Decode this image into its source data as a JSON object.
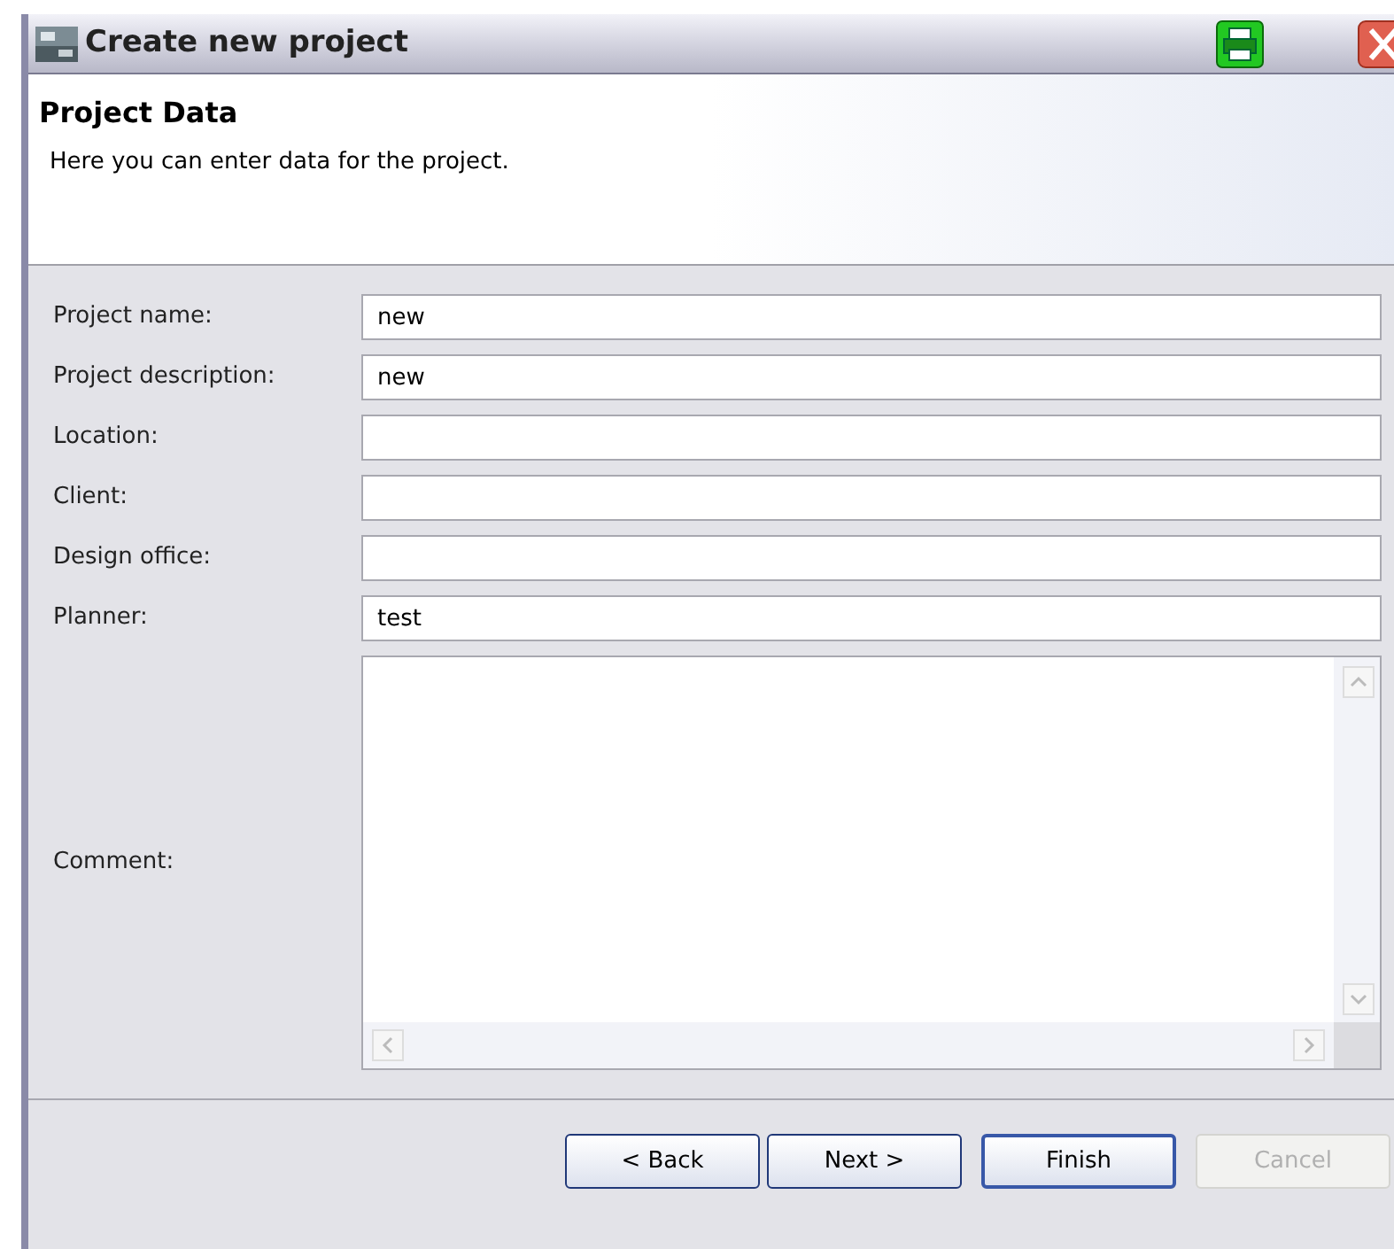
{
  "window": {
    "title": "Create new project"
  },
  "header": {
    "title": "Project Data",
    "description": "Here you can enter data for the project."
  },
  "fields": [
    {
      "label": "Project name:",
      "value": "new"
    },
    {
      "label": "Project description:",
      "value": "new"
    },
    {
      "label": "Location:"
    },
    {
      "label": "Client:"
    },
    {
      "label": "Design office:"
    },
    {
      "label": "Planner:",
      "value": "test"
    }
  ],
  "comment": {
    "label": "Comment:"
  },
  "buttons": [
    {
      "label": "< Back",
      "disabled": false,
      "default": false
    },
    {
      "label": "Next >",
      "disabled": false,
      "default": false
    },
    {
      "label": "Finish",
      "disabled": false,
      "default": true
    },
    {
      "label": "Cancel",
      "disabled": true,
      "default": false
    }
  ]
}
